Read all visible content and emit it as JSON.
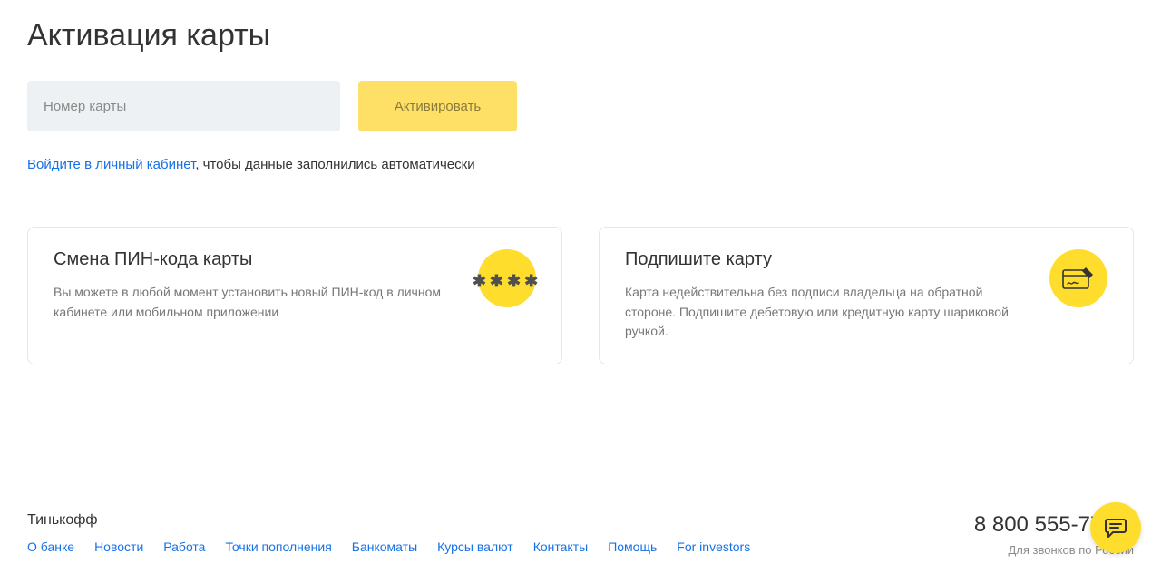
{
  "page": {
    "title": "Активация карты"
  },
  "form": {
    "card_placeholder": "Номер карты",
    "activate_label": "Активировать"
  },
  "login_hint": {
    "link_text": "Войдите в личный кабинет",
    "rest_text": ", чтобы данные заполнились автоматически"
  },
  "cards": {
    "pin": {
      "title": "Смена ПИН-кода карты",
      "desc": "Вы можете в любой момент установить новый ПИН-код в личном кабинете или мобильном приложении"
    },
    "sign": {
      "title": "Подпишите карту",
      "desc": "Карта недействительна без подписи владельца на обратной стороне. Подпишите дебетовую или кредитную карту шариковой ручкой."
    }
  },
  "footer": {
    "brand": "Тинькофф",
    "links": [
      "О банке",
      "Новости",
      "Работа",
      "Точки пополнения",
      "Банкоматы",
      "Курсы валют",
      "Контакты",
      "Помощь",
      "For investors"
    ],
    "phone": "8 800 555-777-8",
    "phone_hint": "Для звонков по России"
  }
}
